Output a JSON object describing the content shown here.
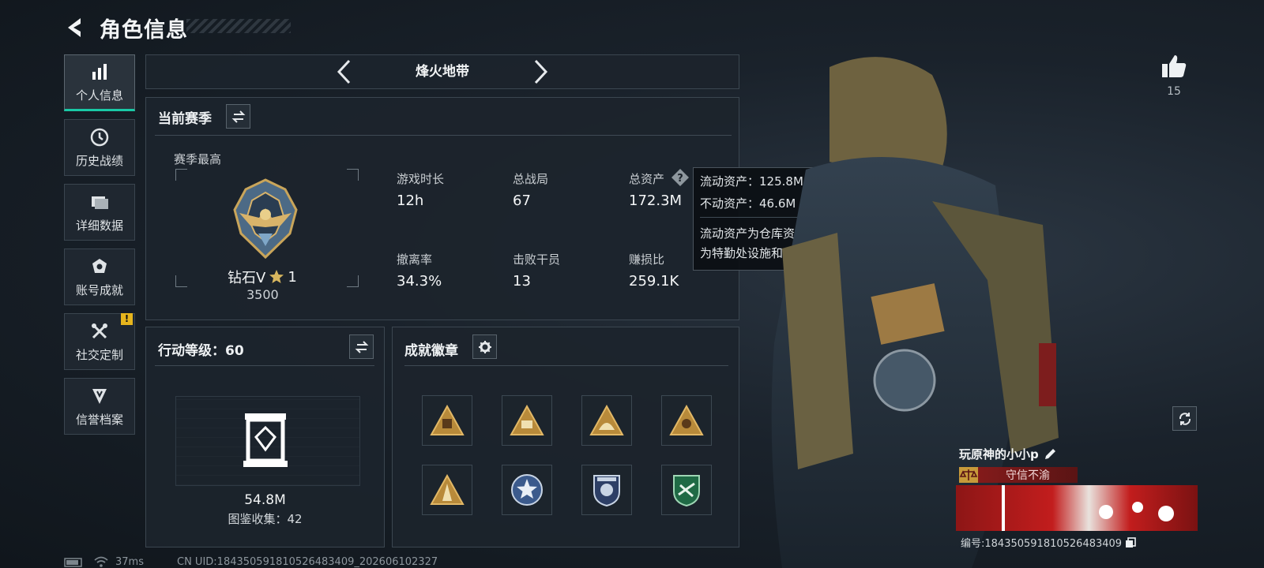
{
  "header": {
    "title": "角色信息"
  },
  "sidebar": {
    "items": [
      {
        "label": "个人信息",
        "icon": "bar-chart-icon",
        "active": true
      },
      {
        "label": "历史战绩",
        "icon": "clock-icon"
      },
      {
        "label": "详细数据",
        "icon": "folder-icon"
      },
      {
        "label": "账号成就",
        "icon": "achievement-icon"
      },
      {
        "label": "社交定制",
        "icon": "wrench-icon",
        "alert": "!"
      },
      {
        "label": "信誉档案",
        "icon": "shield-icon"
      }
    ]
  },
  "mode": {
    "label": "烽火地带"
  },
  "season": {
    "title": "当前赛季",
    "best_label": "赛季最高",
    "rank_name": "钻石V",
    "rank_stars": "1",
    "rank_points": "3500",
    "stats": [
      {
        "label": "游戏时长",
        "value": "12h"
      },
      {
        "label": "总战局",
        "value": "67"
      },
      {
        "label": "总资产",
        "value": "172.3M"
      },
      {
        "label": "撤离率",
        "value": "34.3%"
      },
      {
        "label": "击败干员",
        "value": "13"
      },
      {
        "label": "赚损比",
        "value": "259.1K"
      }
    ]
  },
  "tooltip": {
    "liquid": "流动资产：125.8M",
    "fixed": "不动资产：46.6M",
    "desc1": "流动资产为仓库资产和哈夫币，不动资产",
    "desc2": "为特勤处设施和收藏室设施"
  },
  "level": {
    "title": "行动等级：60",
    "value": "54.8M",
    "collection": "图鉴收集：42"
  },
  "badges": {
    "title": "成就徽章",
    "items": [
      "badge-1",
      "badge-2",
      "badge-3",
      "badge-4",
      "badge-5",
      "badge-6",
      "badge-7",
      "badge-8"
    ]
  },
  "likes": {
    "count": "15"
  },
  "player": {
    "name": "玩原神的小小p",
    "tag": "守信不渝",
    "id_label": "编号:1843505918105264834​09"
  },
  "footer": {
    "ping": "37ms",
    "uid": "CN UID:184350591810526483409_202606102327"
  },
  "colors": {
    "accent": "#19c9a6",
    "warning": "#e7b51d",
    "tag_red": "#8b1c1c"
  }
}
